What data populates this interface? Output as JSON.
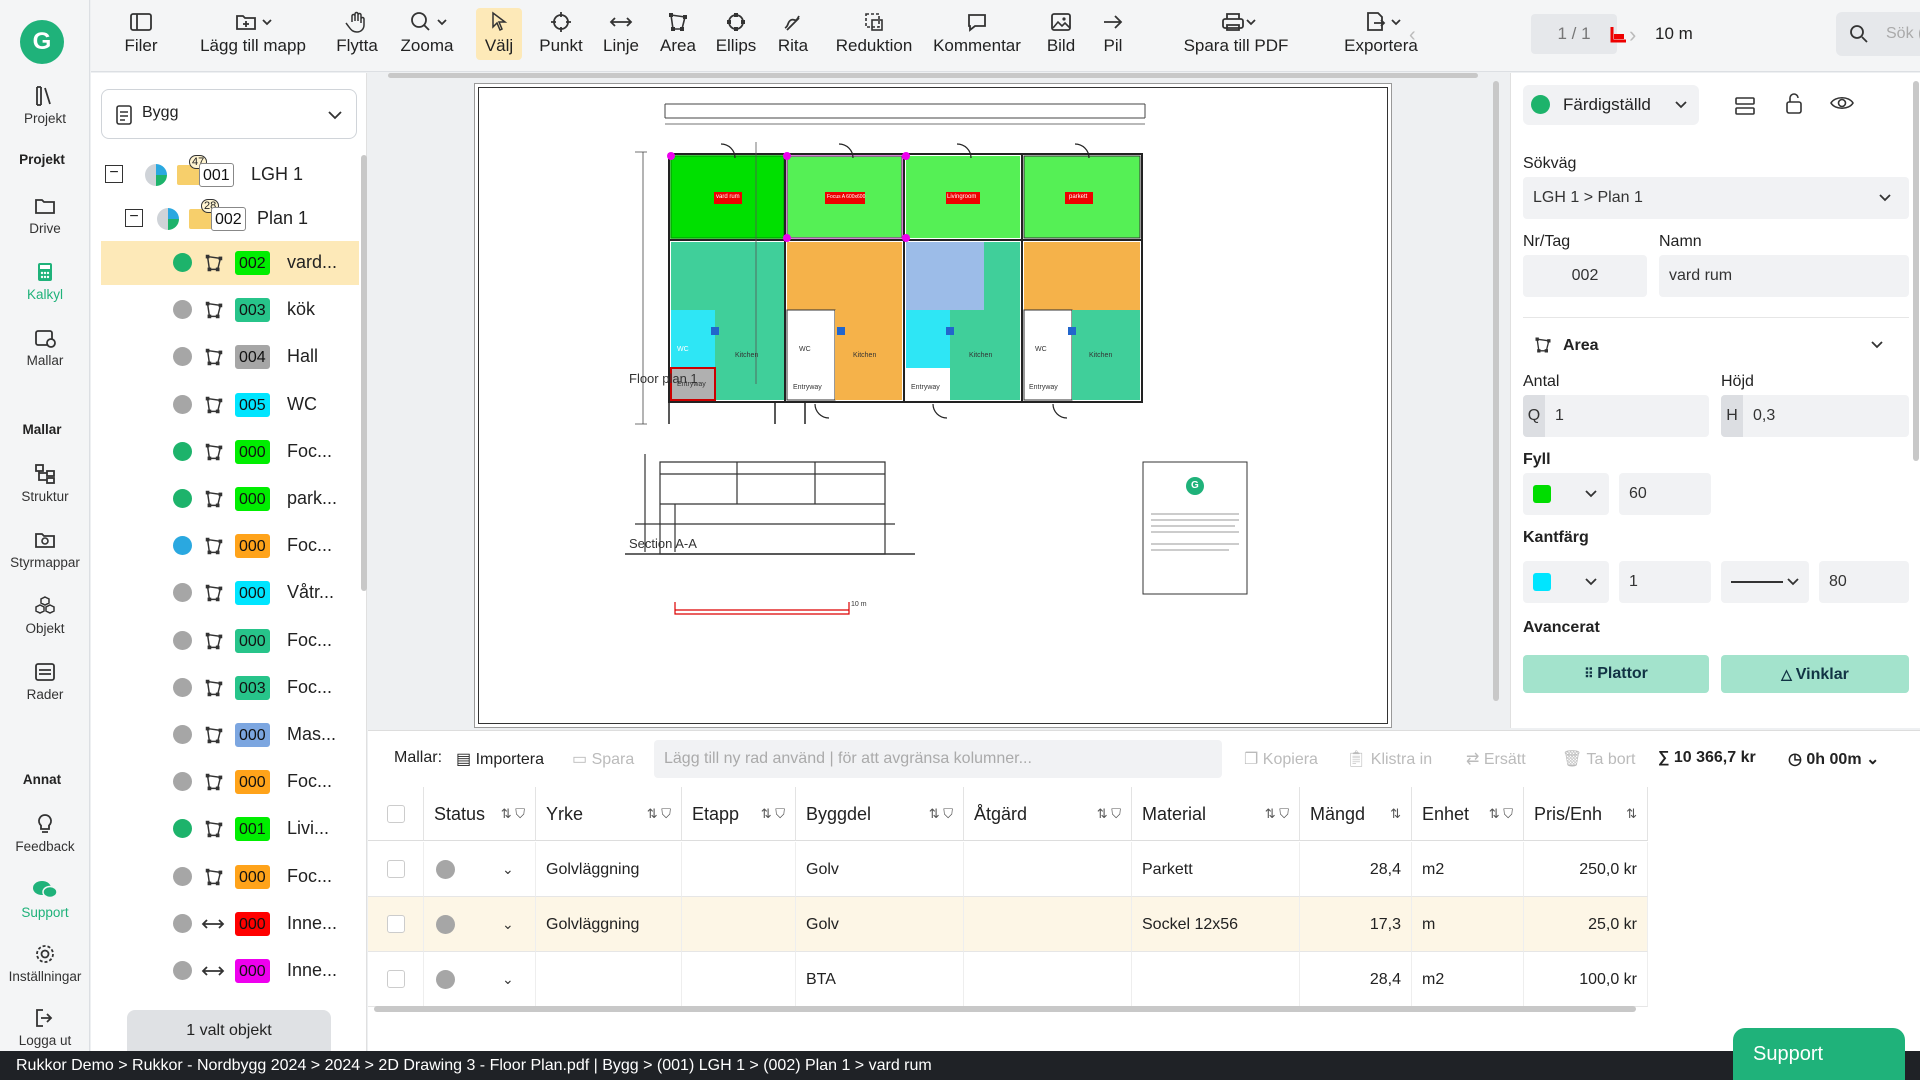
{
  "leftnav": {
    "logo": "G",
    "items": [
      {
        "label": "Projekt",
        "icon": "library-icon"
      },
      {
        "section": "Projekt"
      },
      {
        "label": "Drive",
        "icon": "folder-icon"
      },
      {
        "label": "Kalkyl",
        "icon": "calculator-icon",
        "active": true
      },
      {
        "label": "Mallar",
        "icon": "template-icon"
      },
      {
        "section": "Mallar"
      },
      {
        "label": "Struktur",
        "icon": "structure-icon"
      },
      {
        "label": "Styrmappar",
        "icon": "gear-folder-icon"
      },
      {
        "label": "Objekt",
        "icon": "cubes-icon"
      },
      {
        "label": "Rader",
        "icon": "rows-icon"
      },
      {
        "section": "Annat"
      },
      {
        "label": "Feedback",
        "icon": "lightbulb-icon"
      },
      {
        "label": "Support",
        "icon": "chat-icon",
        "accent": true
      },
      {
        "label": "Inställningar",
        "icon": "gear-icon"
      },
      {
        "label": "Logga ut",
        "icon": "logout-icon"
      }
    ]
  },
  "toolbar": {
    "tools": [
      "Filer",
      "Lägg till mapp",
      "Flytta",
      "Zooma",
      "Välj",
      "Punkt",
      "Linje",
      "Area",
      "Ellips",
      "Rita",
      "Reduktion",
      "Kommentar",
      "Bild",
      "Pil",
      "Spara till PDF",
      "Exportera"
    ],
    "active_tool": "Välj",
    "page": "1 / 1",
    "scale": "10 m",
    "search_placeholder": "Sök (Shift + Mellanslag)"
  },
  "tree": {
    "selector": "Bygg",
    "root": {
      "count": "47",
      "tag": "001",
      "name": "LGH 1"
    },
    "plan": {
      "count": "28",
      "tag": "002",
      "name": "Plan 1"
    },
    "items": [
      {
        "status": "#1db36b",
        "tag": "002",
        "color": "#00ee00",
        "name": "vard...",
        "selected": true,
        "type": "area"
      },
      {
        "status": "#a6a6a6",
        "tag": "003",
        "color": "#27c48a",
        "name": "kök",
        "type": "area"
      },
      {
        "status": "#a6a6a6",
        "tag": "004",
        "color": "#a6a6a6",
        "name": "Hall",
        "type": "area"
      },
      {
        "status": "#a6a6a6",
        "tag": "005",
        "color": "#00e5ff",
        "name": "WC",
        "type": "area"
      },
      {
        "status": "#1db36b",
        "tag": "000",
        "color": "#00ee00",
        "name": "Foc...",
        "type": "area"
      },
      {
        "status": "#1db36b",
        "tag": "000",
        "color": "#00ee00",
        "name": "park...",
        "type": "area"
      },
      {
        "status": "#2aa8e0",
        "tag": "000",
        "color": "#ffa31a",
        "name": "Foc...",
        "type": "area"
      },
      {
        "status": "#a6a6a6",
        "tag": "000",
        "color": "#00e5ff",
        "name": "Våtr...",
        "type": "area"
      },
      {
        "status": "#a6a6a6",
        "tag": "000",
        "color": "#27c48a",
        "name": "Foc...",
        "type": "area"
      },
      {
        "status": "#a6a6a6",
        "tag": "003",
        "color": "#27c48a",
        "name": "Foc...",
        "type": "area"
      },
      {
        "status": "#a6a6a6",
        "tag": "000",
        "color": "#7ca6e0",
        "name": "Mas...",
        "type": "area"
      },
      {
        "status": "#a6a6a6",
        "tag": "000",
        "color": "#ffa31a",
        "name": "Foc...",
        "type": "area"
      },
      {
        "status": "#1db36b",
        "tag": "001",
        "color": "#00ee00",
        "name": "Livi...",
        "type": "area"
      },
      {
        "status": "#a6a6a6",
        "tag": "000",
        "color": "#ffa31a",
        "name": "Foc...",
        "type": "area"
      },
      {
        "status": "#a6a6a6",
        "tag": "000",
        "color": "#ff0000",
        "name": "Inne...",
        "type": "line"
      },
      {
        "status": "#a6a6a6",
        "tag": "000",
        "color": "#ee00ee",
        "name": "Inne...",
        "type": "line"
      }
    ],
    "selected_count": "1 valt objekt"
  },
  "drawing": {
    "floor_plan_label": "Floor plan 1",
    "section_label": "Section A-A",
    "rooms": [
      "vard rum",
      "Focus A 600x600",
      "Livingroom",
      "parkett"
    ],
    "room_labels": [
      "WC",
      "WC",
      "WC",
      "Entryway",
      "Entryway",
      "Entryway",
      "Entryway",
      "Kitchen",
      "Kitchen",
      "Kitchen",
      "Kitchen"
    ],
    "scale_bar": "10 m",
    "legend_logo": "G"
  },
  "props": {
    "status": "Färdigställd",
    "sokvag_label": "Sökväg",
    "sokvag": "LGH 1 > Plan 1",
    "nr_label": "Nr/Tag",
    "nr": "002",
    "namn_label": "Namn",
    "namn": "vard rum",
    "type": "Area",
    "antal_label": "Antal",
    "antal_prefix": "Q",
    "antal": "1",
    "hojd_label": "Höjd",
    "hojd_prefix": "H",
    "hojd": "0,3",
    "fyll_label": "Fyll",
    "fyll_color": "#00dd00",
    "fyll_value": "60",
    "kant_label": "Kantfärg",
    "kant_color": "#00e5ff",
    "kant_width": "1",
    "kant_value": "80",
    "avancerat_label": "Avancerat",
    "btn_plattor": "Plattor",
    "btn_vinklar": "Vinklar"
  },
  "grid": {
    "mallar_label": "Mallar:",
    "importera": "Importera",
    "spara": "Spara",
    "search_placeholder": "Lägg till ny rad använd | för att avgränsa kolumner...",
    "kopiera": "Kopiera",
    "klistra": "Klistra in",
    "ersatt": "Ersätt",
    "tabort": "Ta bort",
    "sum": "10 366,7 kr",
    "time": "0h 00m",
    "columns": [
      "Status",
      "Yrke",
      "Etapp",
      "Byggdel",
      "Åtgärd",
      "Material",
      "Mängd",
      "Enhet",
      "Pris/Enh"
    ],
    "rows": [
      {
        "yrke": "Golvläggning",
        "etapp": "",
        "byggdel": "Golv",
        "atgard": "",
        "material": "Parkett",
        "mangd": "28,4",
        "enhet": "m2",
        "pris": "250,0 kr"
      },
      {
        "yrke": "Golvläggning",
        "etapp": "",
        "byggdel": "Golv",
        "atgard": "",
        "material": "Sockel 12x56",
        "mangd": "17,3",
        "enhet": "m",
        "pris": "25,0 kr",
        "highlight": true
      },
      {
        "yrke": "",
        "etapp": "",
        "byggdel": "BTA",
        "atgard": "",
        "material": "",
        "mangd": "28,4",
        "enhet": "m2",
        "pris": "100,0 kr"
      }
    ]
  },
  "statusbar": {
    "path": "Rukkor Demo > Rukkor - Nordbygg 2024 > 2024 > 2D Drawing 3 - Floor Plan.pdf  |  Bygg > (001) LGH 1 > (002) Plan 1 > vard rum",
    "support": "Support"
  }
}
